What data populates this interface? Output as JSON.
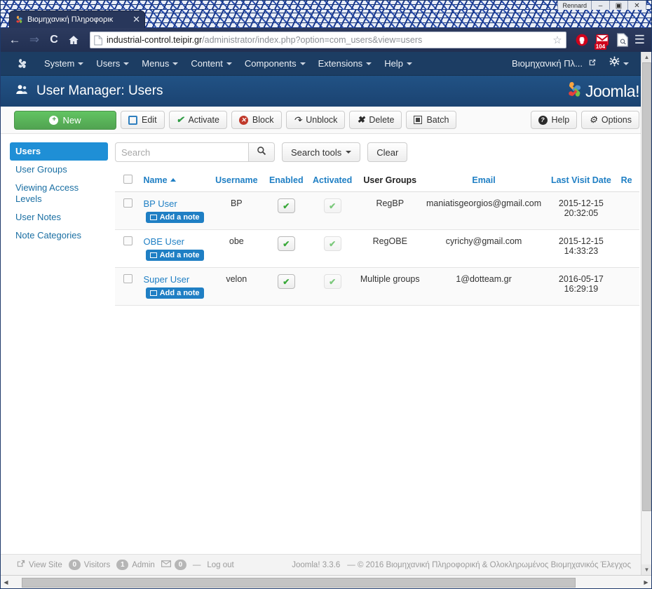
{
  "window": {
    "mini_title": "Rennard",
    "minimize_label": "–",
    "maximize_label": "▣",
    "close_label": "✕"
  },
  "browser": {
    "tab": {
      "title": "Βιομηχανική Πληροφορικ",
      "close_label": "✕",
      "favicon": "joomla-favicon"
    },
    "nav": {
      "back": "←",
      "forward": "⇒",
      "reload": "C",
      "home": "⌂"
    },
    "url": {
      "host": "industrial-control.teipir.gr",
      "path": "/administrator/index.php?option=com_users&view=users",
      "full": "industrial-control.teipir.gr/administrator/index.php?option=com_users&view=users",
      "star": "☆",
      "page_icon": "document-icon"
    },
    "extensions": [
      {
        "name": "adblock-icon",
        "badge": ""
      },
      {
        "name": "gmail-icon",
        "badge": "104"
      },
      {
        "name": "reader-icon",
        "badge": ""
      }
    ],
    "menu_label": "☰"
  },
  "adminmenu": {
    "logo": "joomla-logo-icon",
    "items": [
      {
        "label": "System",
        "caret": true
      },
      {
        "label": "Users",
        "caret": true
      },
      {
        "label": "Menus",
        "caret": true
      },
      {
        "label": "Content",
        "caret": true
      },
      {
        "label": "Components",
        "caret": true
      },
      {
        "label": "Extensions",
        "caret": true
      },
      {
        "label": "Help",
        "caret": true
      }
    ],
    "site_label": "Βιομηχανική Πλ...",
    "site_icon": "external-link-icon",
    "gear_icon": "gear-icon"
  },
  "header": {
    "icon": "users-icon",
    "title": "User Manager: Users",
    "brand": "Joomla!"
  },
  "toolbar": {
    "new_label": "New",
    "edit_label": "Edit",
    "activate_label": "Activate",
    "block_label": "Block",
    "unblock_label": "Unblock",
    "delete_label": "Delete",
    "batch_label": "Batch",
    "help_label": "Help",
    "options_label": "Options"
  },
  "sidebar": {
    "items": [
      {
        "label": "Users",
        "active": true
      },
      {
        "label": "User Groups",
        "active": false
      },
      {
        "label": "Viewing Access Levels",
        "active": false
      },
      {
        "label": "User Notes",
        "active": false
      },
      {
        "label": "Note Categories",
        "active": false
      }
    ]
  },
  "search": {
    "value": "",
    "placeholder": "Search",
    "search_icon": "search-icon",
    "tools_label": "Search tools",
    "clear_label": "Clear"
  },
  "table": {
    "columns": [
      {
        "label": "",
        "key": "checkbox"
      },
      {
        "label": "Name",
        "key": "name",
        "sorted": "asc",
        "link": true
      },
      {
        "label": "Username",
        "key": "username",
        "link": true
      },
      {
        "label": "Enabled",
        "key": "enabled",
        "link": true
      },
      {
        "label": "Activated",
        "key": "activated",
        "link": true
      },
      {
        "label": "User Groups",
        "key": "groups",
        "link": false
      },
      {
        "label": "Email",
        "key": "email",
        "link": true
      },
      {
        "label": "Last Visit Date",
        "key": "lastvisit",
        "link": true
      },
      {
        "label": "Re",
        "key": "registration",
        "link": true
      }
    ],
    "note_label": "Add a note",
    "check_glyph": "✔",
    "rows": [
      {
        "name": "BP User",
        "username": "BP",
        "enabled": true,
        "activated": true,
        "groups": "RegBP",
        "email": "maniatisgeorgios@gmail.com",
        "lastvisit_date": "2015-12-15",
        "lastvisit_time": "20:32:05"
      },
      {
        "name": "OBE User",
        "username": "obe",
        "enabled": true,
        "activated": true,
        "groups": "RegOBE",
        "email": "cyrichy@gmail.com",
        "lastvisit_date": "2015-12-15",
        "lastvisit_time": "14:33:23"
      },
      {
        "name": "Super User",
        "username": "velon",
        "enabled": true,
        "activated": true,
        "groups": "Multiple groups",
        "email": "1@dotteam.gr",
        "lastvisit_date": "2016-05-17",
        "lastvisit_time": "16:29:19"
      }
    ]
  },
  "footer": {
    "view_site": "View Site",
    "visitors_count": "0",
    "visitors_label": "Visitors",
    "admin_count": "1",
    "admin_label": "Admin",
    "messages_icon": "envelope-icon",
    "messages_count": "0",
    "separator": "—",
    "logout": "Log out",
    "version": "Joomla! 3.3.6",
    "copyright": "—  © 2016 Βιομηχανική Πληροφορική & Ολοκληρωμένος Βιομηχανικός Έλεγχος"
  },
  "colors": {
    "accent": "#1f7fc4",
    "admin_bar": "#1c3d63",
    "header": "#215285",
    "new_button": "#51a351",
    "active_sidebar": "#1f8fd6"
  }
}
